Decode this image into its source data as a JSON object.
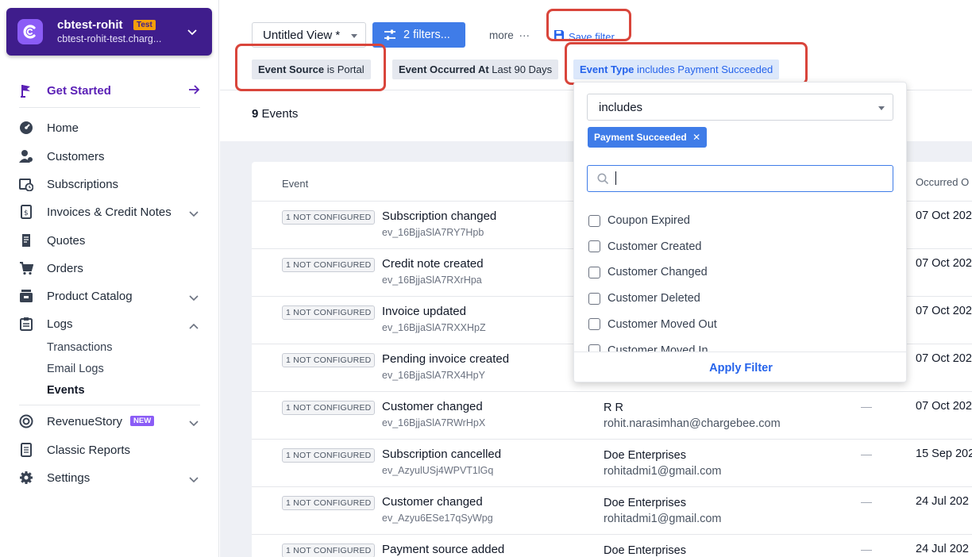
{
  "account": {
    "name": "cbtest-rohit",
    "badge": "Test",
    "domain": "cbtest-rohit-test.charg..."
  },
  "sidebar": {
    "get_started": "Get Started",
    "items": [
      {
        "label": "Home",
        "icon": "dashboard-icon"
      },
      {
        "label": "Customers",
        "icon": "customers-icon"
      },
      {
        "label": "Subscriptions",
        "icon": "calendar-clock-icon"
      },
      {
        "label": "Invoices & Credit Notes",
        "icon": "invoice-icon"
      },
      {
        "label": "Quotes",
        "icon": "quote-icon"
      },
      {
        "label": "Orders",
        "icon": "cart-icon"
      },
      {
        "label": "Product Catalog",
        "icon": "catalog-icon"
      },
      {
        "label": "Logs",
        "icon": "clipboard-icon"
      }
    ],
    "logs_sub": [
      "Transactions",
      "Email Logs",
      "Events"
    ],
    "revenuestory": "RevenueStory",
    "new_badge": "NEW",
    "classic_reports": "Classic Reports",
    "settings": "Settings"
  },
  "toolbar": {
    "view_name": "Untitled View *",
    "filters_label": "2 filters...",
    "more_label": "more",
    "save_filter_label": "Save filter"
  },
  "chips": [
    {
      "field": "Event Source",
      "rest": " is Portal"
    },
    {
      "field": "Event Occurred At",
      "rest": " Last 90 Days"
    },
    {
      "field": "Event Type",
      "rest": " includes Payment Succeeded"
    }
  ],
  "events_count": "9",
  "events_count_label": " Events",
  "table": {
    "headers": {
      "event": "Event",
      "occurred_on": "Occurred O"
    },
    "not_configured": "1 NOT CONFIGURED",
    "rows": [
      {
        "title": "Subscription changed",
        "id": "ev_16BjjaSlA7RY7Hpb",
        "customer": "",
        "email": "",
        "dash": "",
        "date": "07 Oct 202"
      },
      {
        "title": "Credit note created",
        "id": "ev_16BjjaSlA7RXrHpa",
        "customer": "",
        "email": "",
        "dash": "",
        "date": "07 Oct 202"
      },
      {
        "title": "Invoice updated",
        "id": "ev_16BjjaSlA7RXXHpZ",
        "customer": "",
        "email": "",
        "dash": "",
        "date": "07 Oct 202"
      },
      {
        "title": "Pending invoice created",
        "id": "ev_16BjjaSlA7RX4HpY",
        "customer": "",
        "email": "",
        "dash": "",
        "date": "07 Oct 202"
      },
      {
        "title": "Customer changed",
        "id": "ev_16BjjaSlA7RWrHpX",
        "customer": "R R",
        "email": "rohit.narasimhan@chargebee.com",
        "dash": "—",
        "date": "07 Oct 202"
      },
      {
        "title": "Subscription cancelled",
        "id": "ev_AzyulUSj4WPVT1lGq",
        "customer": "Doe Enterprises",
        "email": "rohitadmi1@gmail.com",
        "dash": "—",
        "date": "15 Sep 202"
      },
      {
        "title": "Customer changed",
        "id": "ev_Azyu6ESe17qSyWpg",
        "customer": "Doe Enterprises",
        "email": "rohitadmi1@gmail.com",
        "dash": "—",
        "date": "24 Jul 202"
      },
      {
        "title": "Payment source added",
        "id": "",
        "customer": "Doe Enterprises",
        "email": "",
        "dash": "—",
        "date": "24 Jul 202"
      }
    ]
  },
  "dropdown": {
    "operator": "includes",
    "selected_tag": "Payment Succeeded",
    "search_placeholder": "",
    "options": [
      "Coupon Expired",
      "Customer Created",
      "Customer Changed",
      "Customer Deleted",
      "Customer Moved Out",
      "Customer Moved In"
    ],
    "apply_label": "Apply Filter"
  },
  "colors": {
    "accent": "#3f7ce8",
    "brand": "#3f1d8c",
    "annotation": "#d9453b"
  }
}
